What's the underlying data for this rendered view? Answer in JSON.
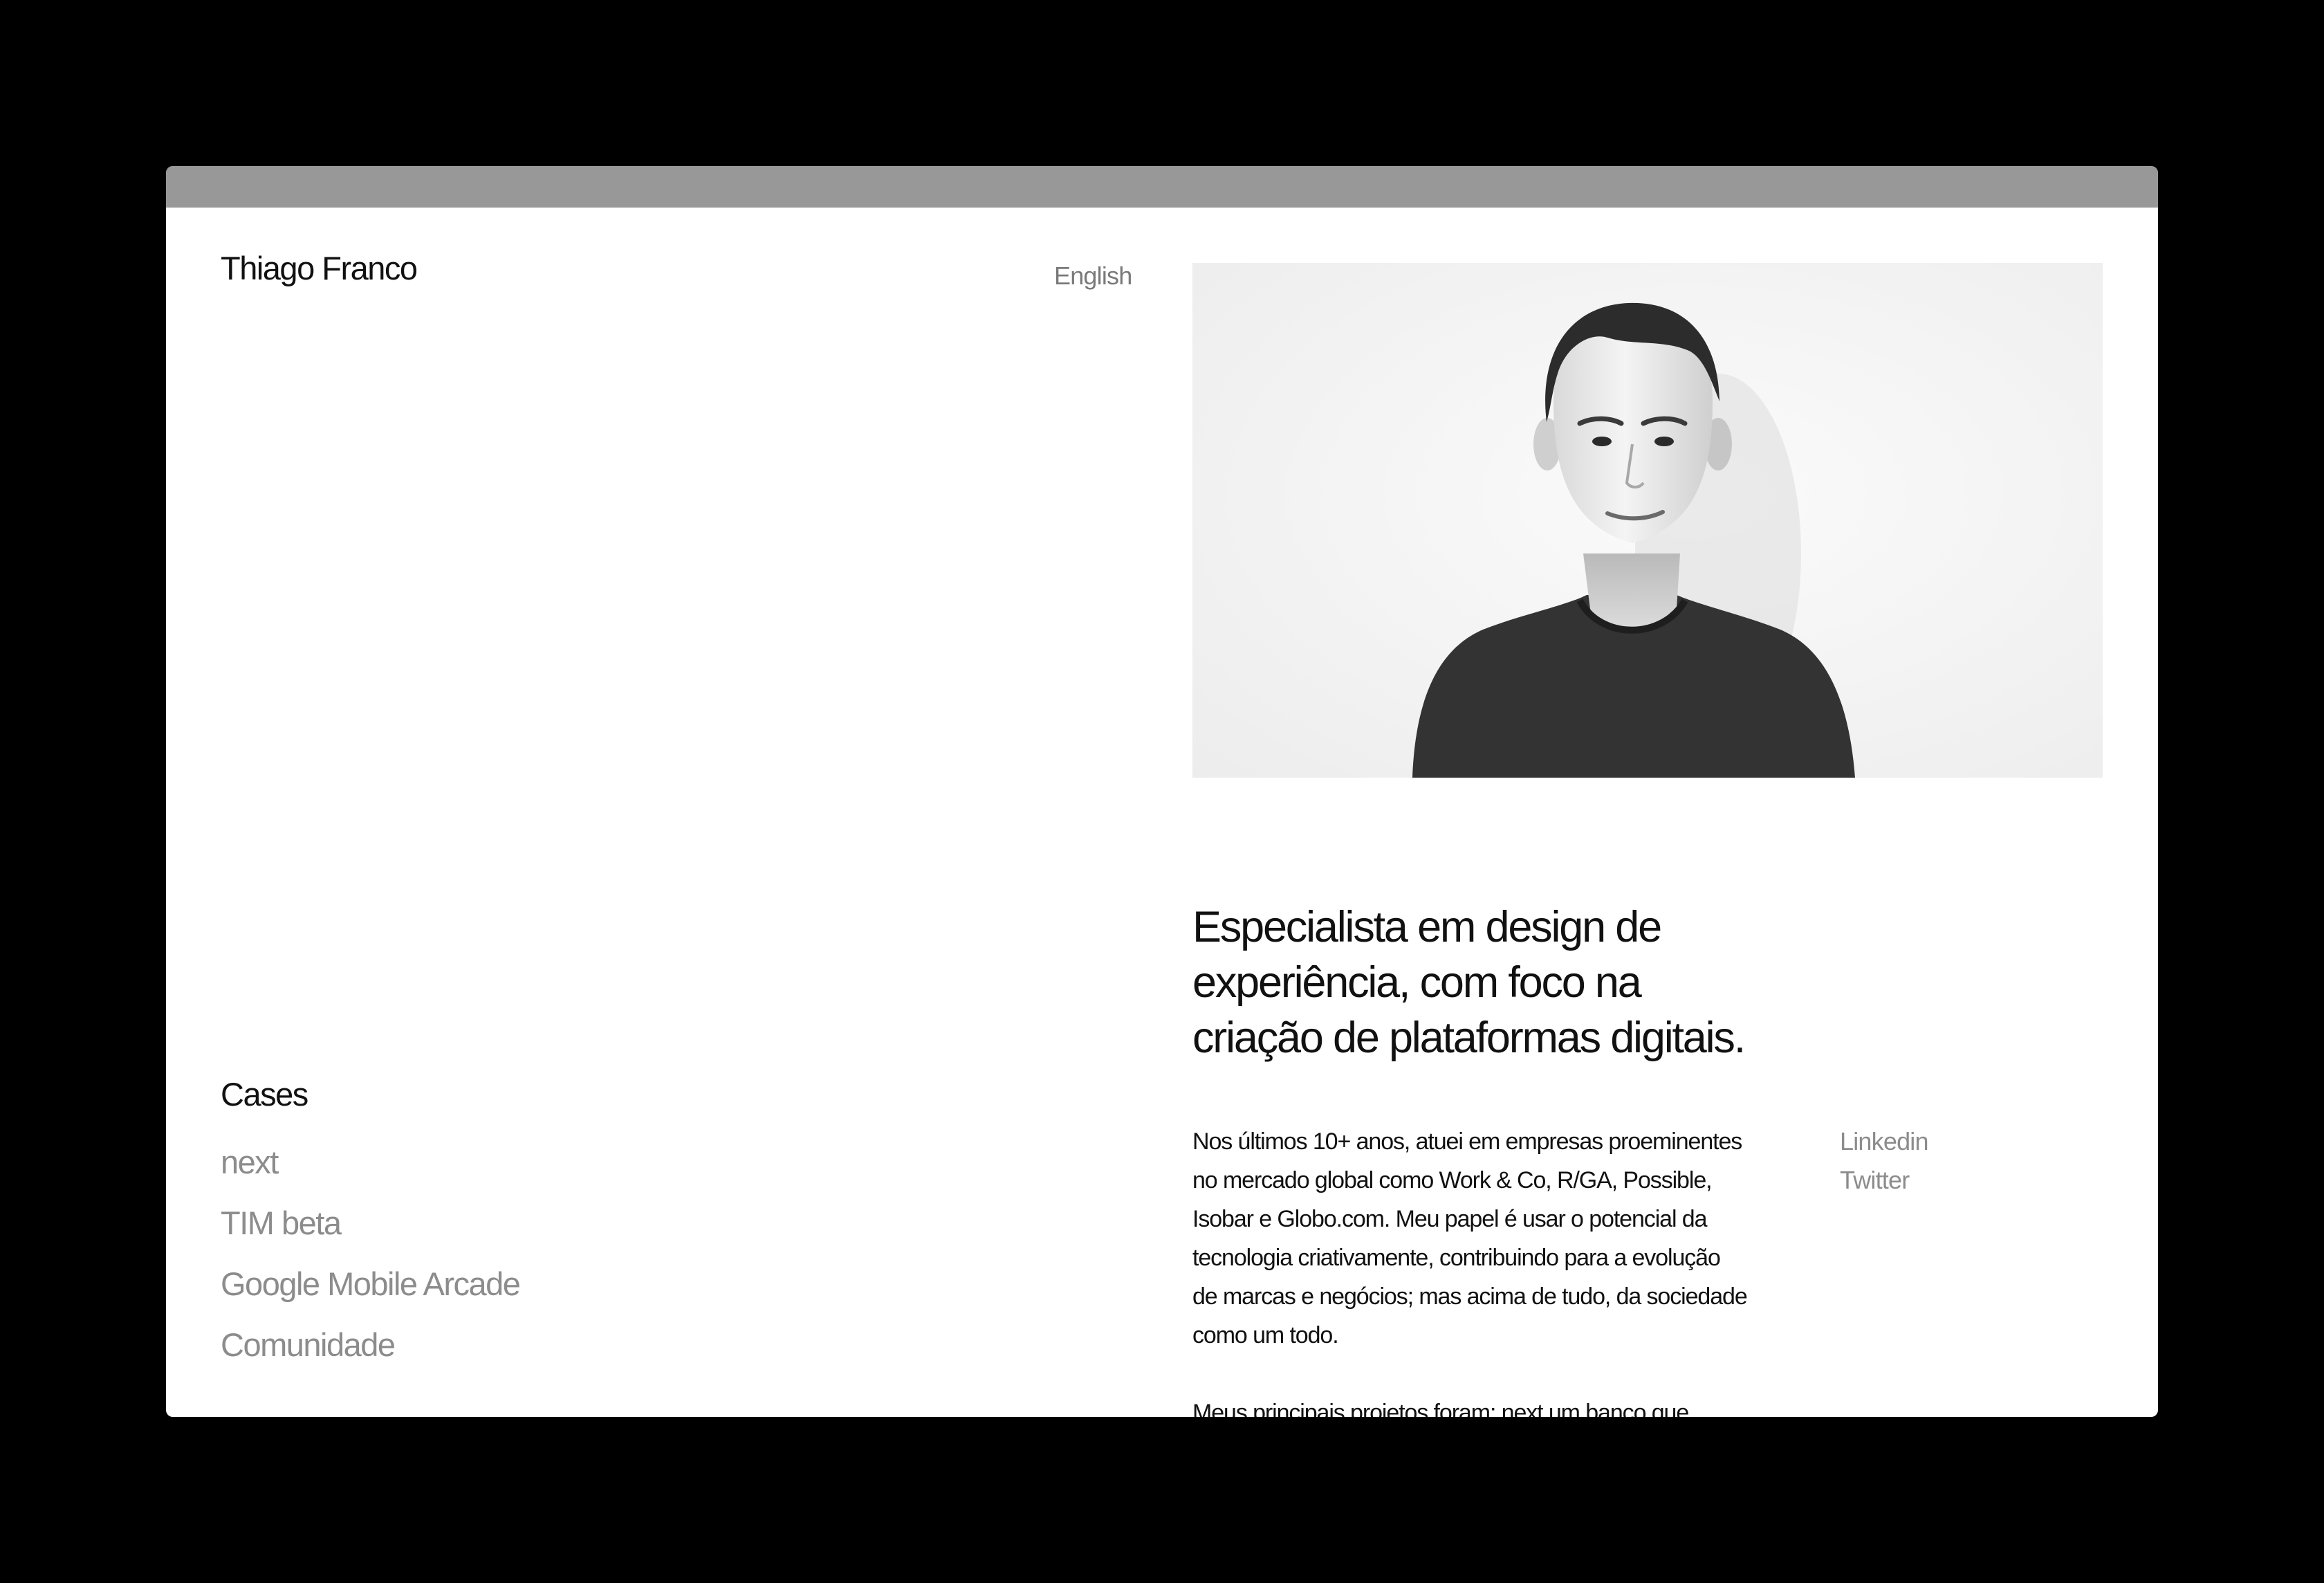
{
  "header": {
    "site_name": "Thiago Franco",
    "language_link": "English"
  },
  "portrait": {
    "alt": "Thiago Franco"
  },
  "cases": {
    "heading": "Cases",
    "items": [
      {
        "label": "next"
      },
      {
        "label": "TIM beta"
      },
      {
        "label": "Google Mobile Arcade"
      },
      {
        "label": "Comunidade"
      }
    ]
  },
  "intro": {
    "headline_lines": [
      "Especialista em design de",
      "experiência, com foco na",
      "criação de plataformas digitais."
    ],
    "bio_lines": [
      "Nos últimos 10+ anos, atuei em empresas proeminentes",
      "no mercado global como Work & Co, R/GA, Possible,",
      "Isobar e Globo.com. Meu papel é usar o potencial da",
      "tecnologia criativamente, contribuindo para a evolução",
      "de marcas e negócios; mas acima de tudo, da sociedade",
      "como um todo."
    ],
    "bio_second_paragraph": "Meus principais projetos foram: next um banco que"
  },
  "social": {
    "linkedin": "Linkedin",
    "twitter": "Twitter"
  },
  "colors": {
    "background": "#000000",
    "page": "#ffffff",
    "titlebar": "#989898",
    "text_primary": "#111111",
    "text_muted": "#8c8c8c"
  }
}
